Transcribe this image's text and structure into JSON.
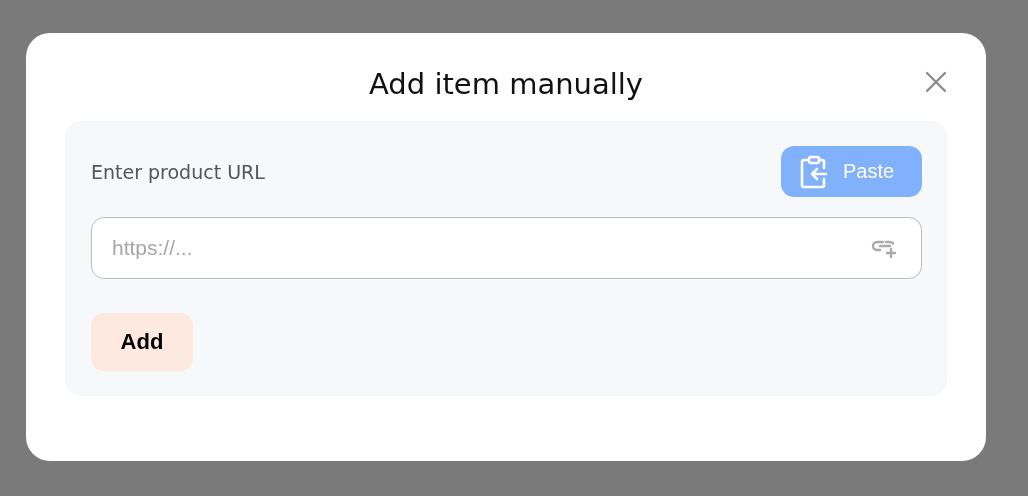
{
  "dialog": {
    "title": "Add item manually"
  },
  "url_section": {
    "label": "Enter product URL",
    "paste_button": "Paste",
    "url_field": {
      "placeholder": "https://..."
    }
  },
  "add_button": "Add"
}
